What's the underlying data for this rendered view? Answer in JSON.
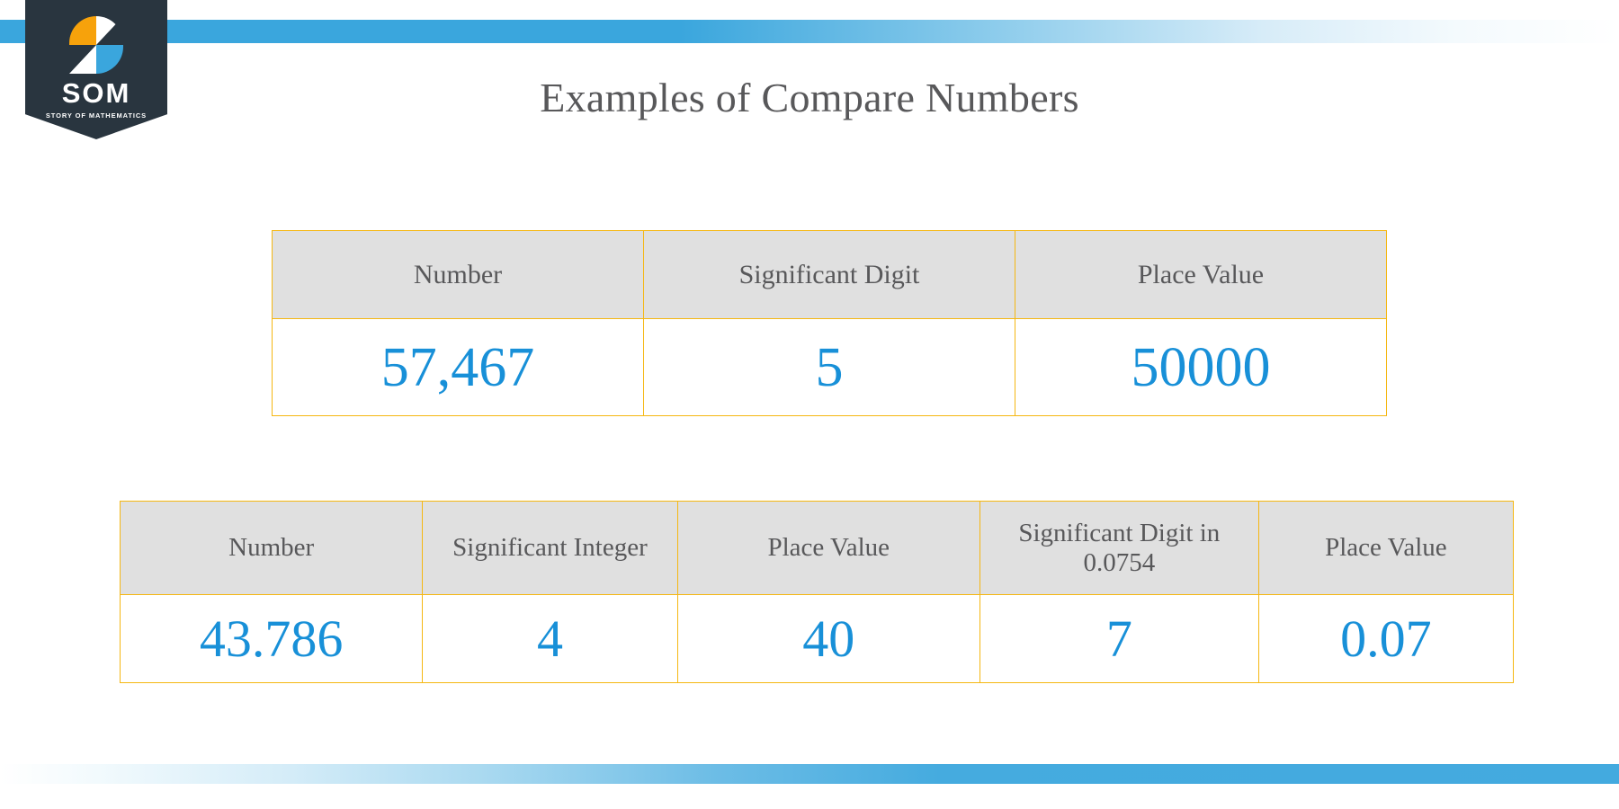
{
  "brand": {
    "logo_text": "SOM",
    "tagline": "STORY OF MATHEMATICS",
    "colors": {
      "badge_bg": "#29353f",
      "orange": "#f7a20b",
      "blue": "#3aa6dd",
      "white": "#ffffff"
    }
  },
  "title": "Examples of Compare Numbers",
  "colors": {
    "title_text": "#58585a",
    "table_border": "#f5b712",
    "header_bg": "#e0e0e0",
    "value_text": "#1890d8",
    "accent_bar": "#43aadf"
  },
  "tables": [
    {
      "id": "table-one",
      "headers": [
        "Number",
        "Significant Digit",
        "Place Value"
      ],
      "rows": [
        [
          "57,467",
          "5",
          "50000"
        ]
      ]
    },
    {
      "id": "table-two",
      "headers": [
        "Number",
        "Significant Integer",
        "Place Value",
        "Significant Digit in 0.0754",
        "Place Value"
      ],
      "rows": [
        [
          "43.786",
          "4",
          "40",
          "7",
          "0.07"
        ]
      ]
    }
  ]
}
